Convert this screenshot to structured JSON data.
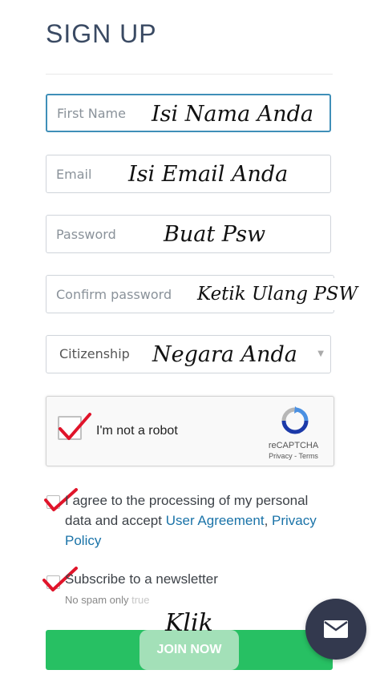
{
  "page": {
    "title": "SIGN UP"
  },
  "form": {
    "first_name": {
      "placeholder": "First Name",
      "note": "Isi Nama Anda"
    },
    "email": {
      "placeholder": "Email",
      "note": "Isi Email Anda"
    },
    "password": {
      "placeholder": "Password",
      "note": "Buat Psw"
    },
    "confirm_password": {
      "placeholder": "Confirm password",
      "note": "Ketik Ulang PSW"
    },
    "citizenship": {
      "label": "Citizenship",
      "note": "Negara Anda"
    }
  },
  "captcha": {
    "label": "I'm not a robot",
    "brand": "reCAPTCHA",
    "privacy": "Privacy",
    "separator": "-",
    "terms": "Terms"
  },
  "agreement": {
    "text_1": "I agree to the processing of my personal data and accept",
    "user_agreement": "User Agreement",
    "comma": ",",
    "privacy_policy": "Privacy Policy"
  },
  "newsletter": {
    "label": "Subscribe to a newsletter",
    "note": "No spam only",
    "note_suffix": "true"
  },
  "submit": {
    "note": "Klik",
    "label": "JOIN NOW"
  },
  "colors": {
    "title": "#3a4a63",
    "active_border": "#3f8fb8",
    "link": "#1a73a8",
    "join_button": "#27c063",
    "fab": "#33394e",
    "annotation_check": "#e0142a"
  },
  "icons": {
    "select_caret": "caret-down-icon",
    "recaptcha": "recaptcha-logo-icon",
    "fab": "envelope-icon",
    "check": "red-check-icon"
  }
}
